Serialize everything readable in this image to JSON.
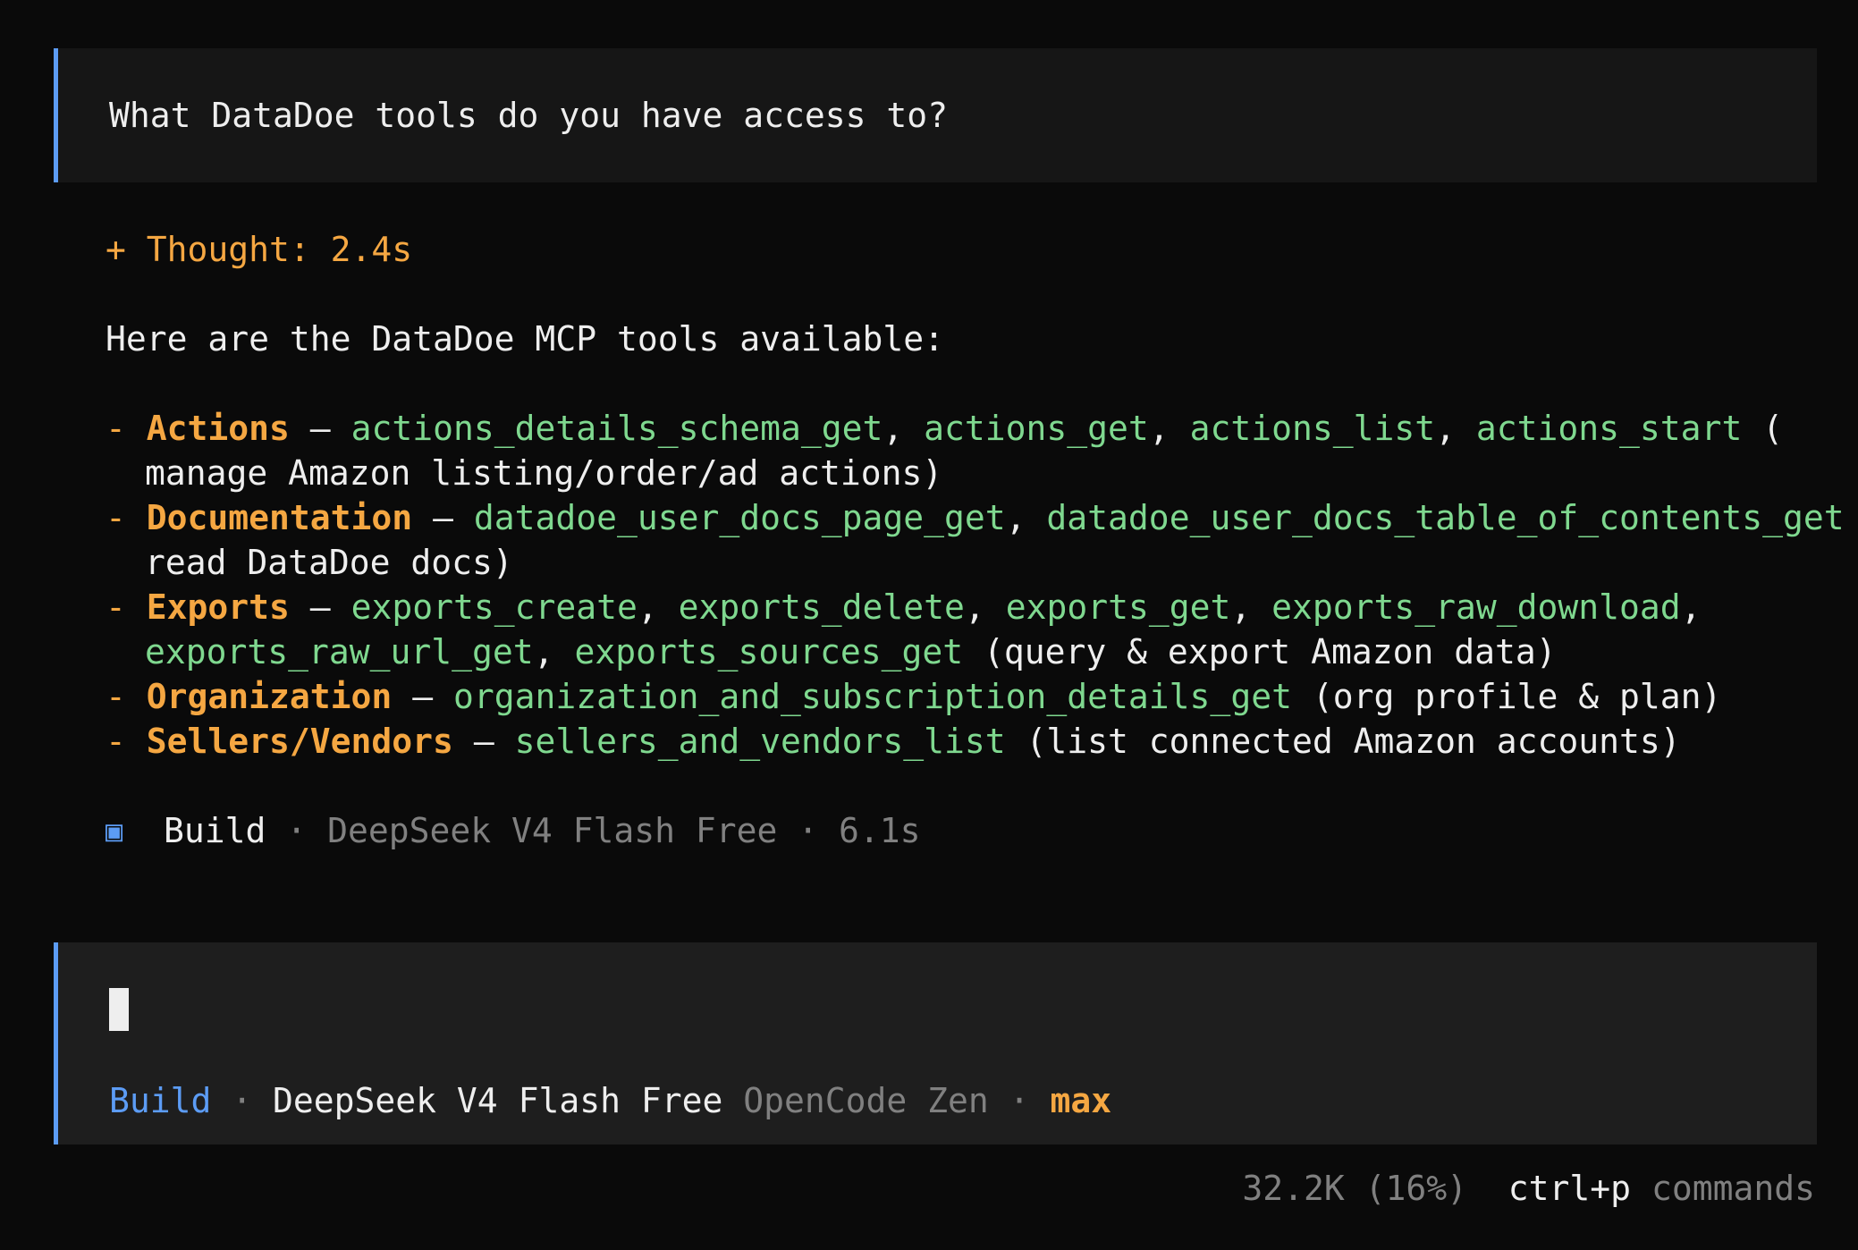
{
  "user_message": "What DataDoe tools do you have access to?",
  "response": {
    "thought": "+ Thought: 2.4s",
    "intro": "Here are the DataDoe MCP tools available:",
    "items": [
      {
        "dash": "- ",
        "category": "Actions",
        "sep": " – ",
        "line1_tools": [
          "actions_details_schema_get",
          "actions_get",
          "actions_list",
          "actions_start"
        ],
        "line1_tail": " (",
        "line2_text": "manage Amazon listing/order/ad actions)"
      },
      {
        "dash": "- ",
        "category": "Documentation",
        "sep": " – ",
        "line1_tools": [
          "datadoe_user_docs_page_get",
          "datadoe_user_docs_table_of_contents_get"
        ],
        "line1_tail": " (",
        "line2_text": "read DataDoe docs)"
      },
      {
        "dash": "- ",
        "category": "Exports",
        "sep": " – ",
        "line1_tools": [
          "exports_create",
          "exports_delete",
          "exports_get",
          "exports_raw_download"
        ],
        "line1_tail": ",",
        "line2_tools": [
          "exports_raw_url_get",
          "exports_sources_get"
        ],
        "line2_text": " (query & export Amazon data)"
      },
      {
        "dash": "- ",
        "category": "Organization",
        "sep": " – ",
        "line1_tools": [
          "organization_and_subscription_details_get"
        ],
        "line1_tail": " (org profile & plan)"
      },
      {
        "dash": "- ",
        "category": "Sellers/Vendors",
        "sep": " – ",
        "line1_tools": [
          "sellers_and_vendors_list"
        ],
        "line1_tail": " (list connected Amazon accounts)"
      }
    ],
    "meta": {
      "icon": "▣",
      "agent": "Build",
      "dot": " · ",
      "model": "DeepSeek V4 Flash Free",
      "duration": "6.1s"
    }
  },
  "prompt": {
    "agent": "Build",
    "dot": " · ",
    "model": "DeepSeek V4 Flash Free",
    "provider": "OpenCode Zen",
    "variant": "max"
  },
  "footer": {
    "tokens": "32.2K (16%)",
    "shortcut": "ctrl+p",
    "label": "commands"
  }
}
